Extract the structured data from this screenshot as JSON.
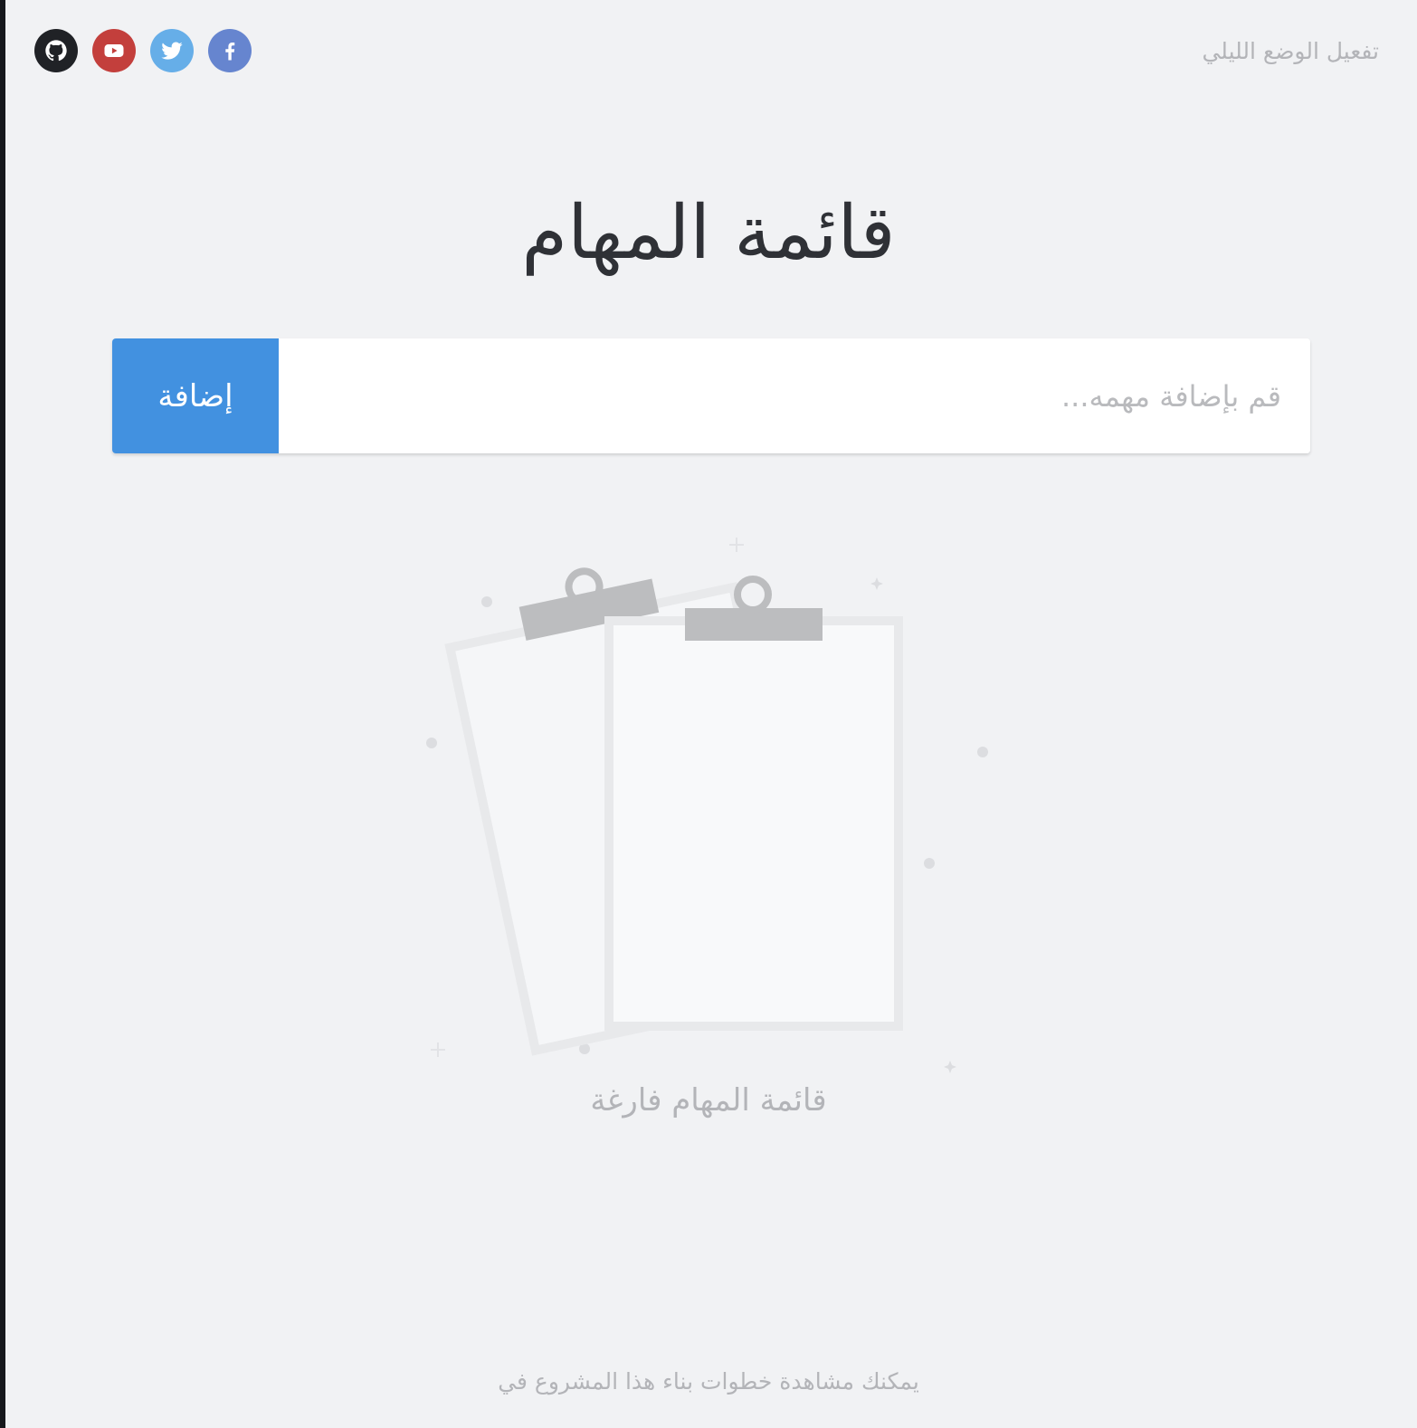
{
  "header": {
    "night_mode_label": "تفعيل الوضع الليلي",
    "social_links": [
      {
        "icon": "github-icon",
        "color": "#202226"
      },
      {
        "icon": "youtube-icon",
        "color": "#c33f3c"
      },
      {
        "icon": "twitter-icon",
        "color": "#66aee8"
      },
      {
        "icon": "facebook-icon",
        "color": "#6685cf"
      }
    ]
  },
  "main": {
    "title": "قائمة المهام",
    "input": {
      "placeholder": "قم بإضافة مهمه...",
      "value": ""
    },
    "add_button_label": "إضافة",
    "empty_state": {
      "icon": "clipboard-icon",
      "message": "قائمة المهام فارغة"
    }
  },
  "footer": {
    "text": "يمكنك مشاهدة خطوات بناء هذا المشروع في"
  },
  "colors": {
    "background": "#f1f2f4",
    "accent": "#4291e0",
    "muted_text": "#b3b4b8",
    "title_text": "#2f3136"
  }
}
